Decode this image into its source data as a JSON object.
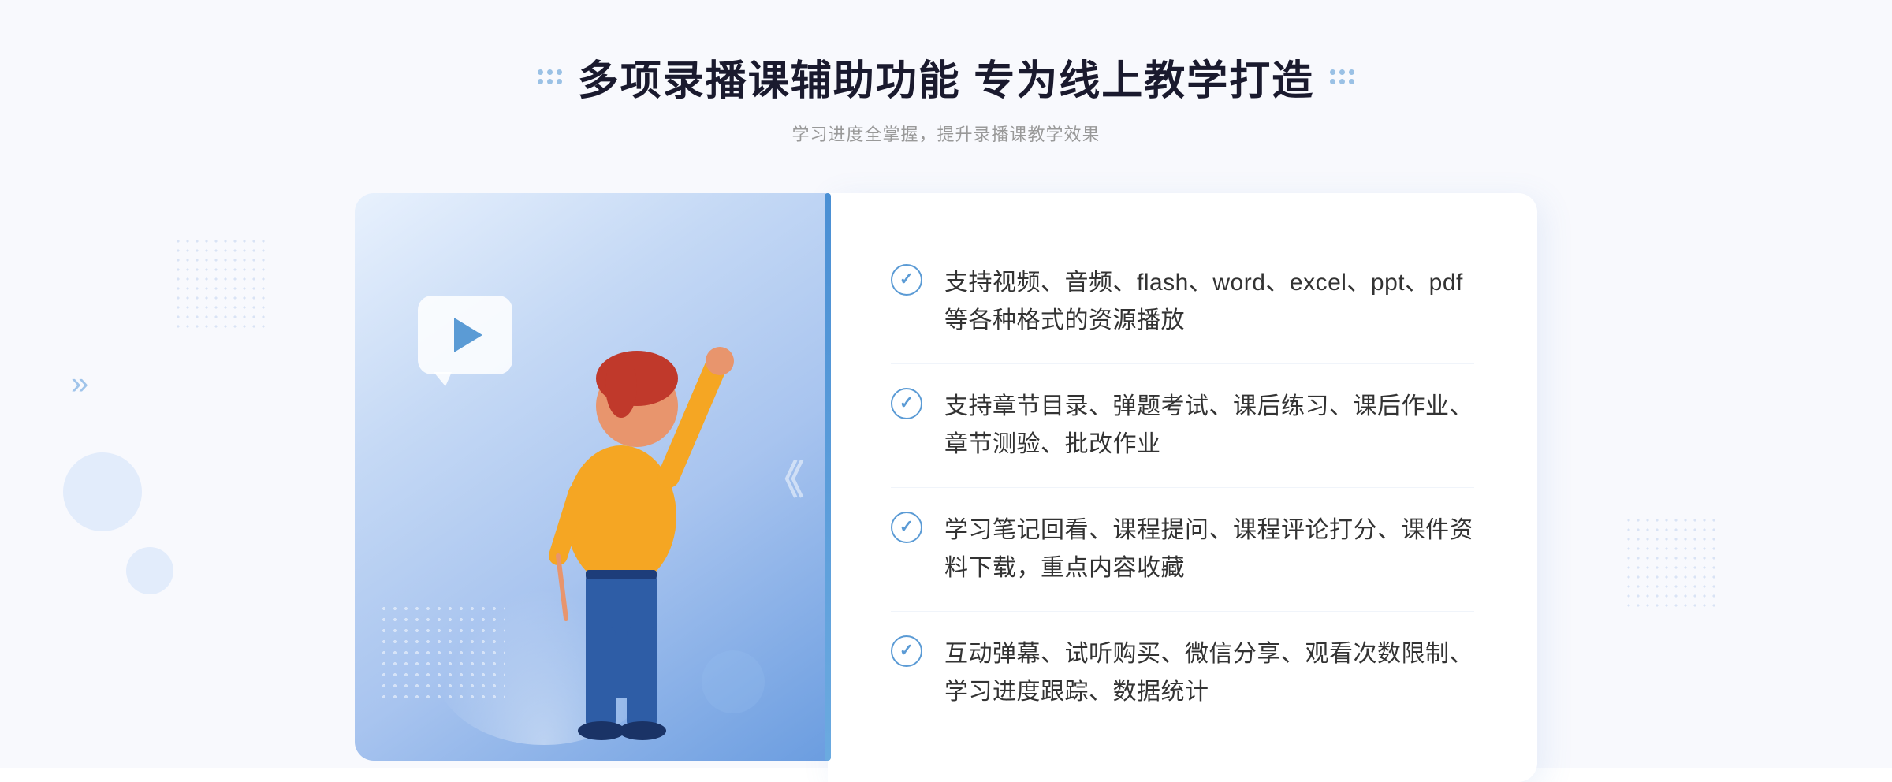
{
  "page": {
    "background": "#f8f9fd"
  },
  "header": {
    "main_title": "多项录播课辅助功能 专为线上教学打造",
    "subtitle": "学习进度全掌握，提升录播课教学效果"
  },
  "features": [
    {
      "id": 1,
      "text": "支持视频、音频、flash、word、excel、ppt、pdf等各种格式的资源播放"
    },
    {
      "id": 2,
      "text": "支持章节目录、弹题考试、课后练习、课后作业、章节测验、批改作业"
    },
    {
      "id": 3,
      "text": "学习笔记回看、课程提问、课程评论打分、课件资料下载，重点内容收藏"
    },
    {
      "id": 4,
      "text": "互动弹幕、试听购买、微信分享、观看次数限制、学习进度跟踪、数据统计"
    }
  ],
  "decorative": {
    "arrows_left": "»",
    "arrows_right": "»",
    "check_symbol": "✓"
  }
}
